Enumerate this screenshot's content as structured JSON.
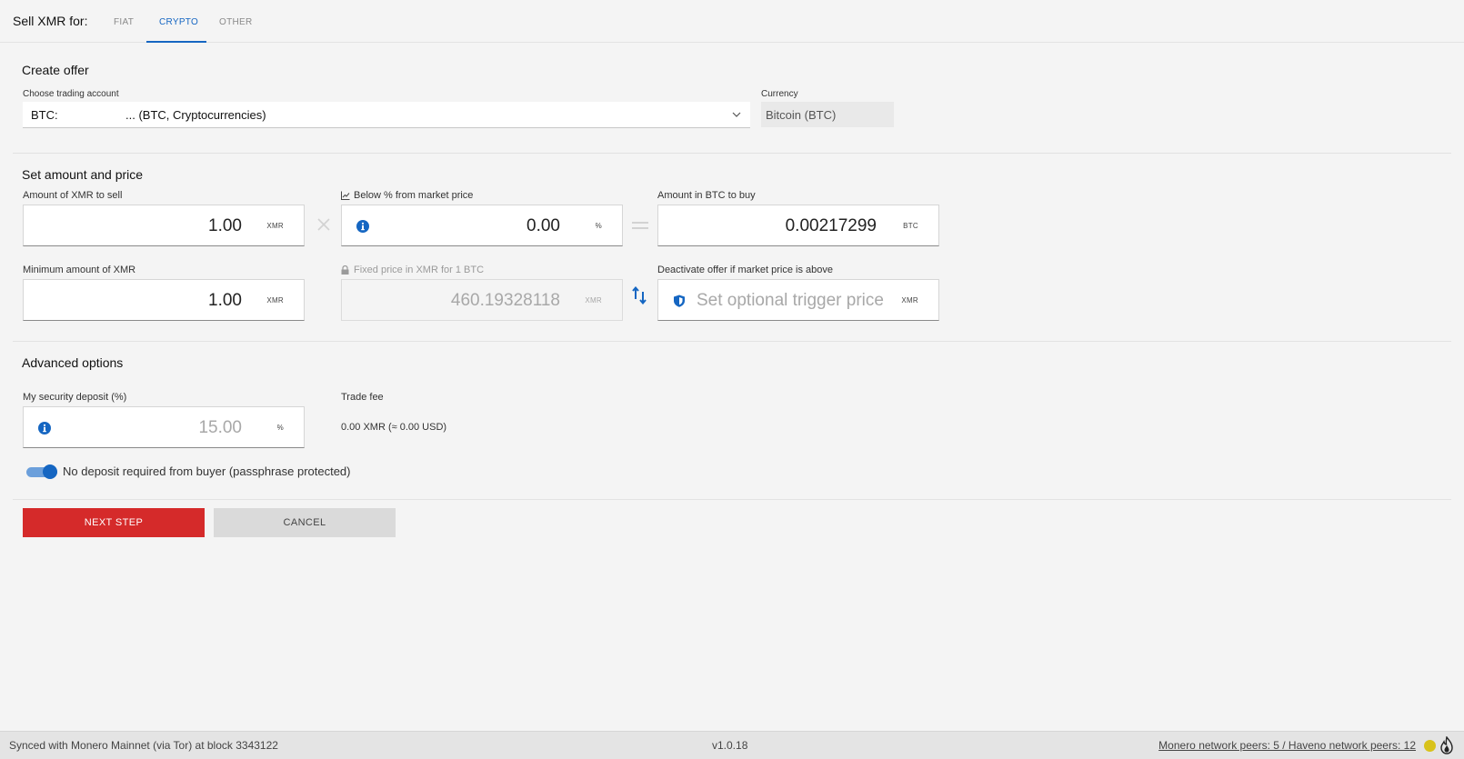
{
  "header": {
    "title": "Sell XMR for:",
    "tabs": [
      {
        "label": "FIAT",
        "active": false
      },
      {
        "label": "CRYPTO",
        "active": true
      },
      {
        "label": "OTHER",
        "active": false
      }
    ]
  },
  "create_offer": {
    "title": "Create offer",
    "account_label": "Choose trading account",
    "account_value_prefix": "BTC:",
    "account_value": "... (BTC, Cryptocurrencies)",
    "currency_label": "Currency",
    "currency_value": "Bitcoin (BTC)"
  },
  "amount_price": {
    "title": "Set amount and price",
    "amount_label": "Amount of XMR to sell",
    "amount_value": "1.00",
    "amount_unit": "XMR",
    "below_label": "Below % from market price",
    "below_value": "0.00",
    "below_unit": "%",
    "btc_label": "Amount in BTC to buy",
    "btc_value": "0.00217299",
    "btc_unit": "BTC",
    "min_label": "Minimum amount of XMR",
    "min_value": "1.00",
    "min_unit": "XMR",
    "fixed_label": "Fixed price in XMR for 1 BTC",
    "fixed_value": "460.19328118",
    "fixed_unit": "XMR",
    "trigger_label": "Deactivate offer if market price is above",
    "trigger_placeholder": "Set optional trigger price",
    "trigger_unit": "XMR"
  },
  "advanced": {
    "title": "Advanced options",
    "deposit_label": "My security deposit (%)",
    "deposit_value": "15.00",
    "deposit_unit": "%",
    "fee_label": "Trade fee",
    "fee_value": "0.00 XMR (≈ 0.00 USD)",
    "toggle_label": "No deposit required from buyer (passphrase protected)",
    "toggle_on": true
  },
  "actions": {
    "next_label": "NEXT STEP",
    "cancel_label": "CANCEL"
  },
  "status": {
    "sync_text": "Synced with Monero Mainnet (via Tor) at block 3343122",
    "version": "v1.0.18",
    "peers_text": "Monero network peers: 5 / Haveno network peers: 12"
  },
  "colors": {
    "accent": "#1566c2",
    "primary_button": "#d52a2a",
    "status_dot": "#d8c21a"
  }
}
